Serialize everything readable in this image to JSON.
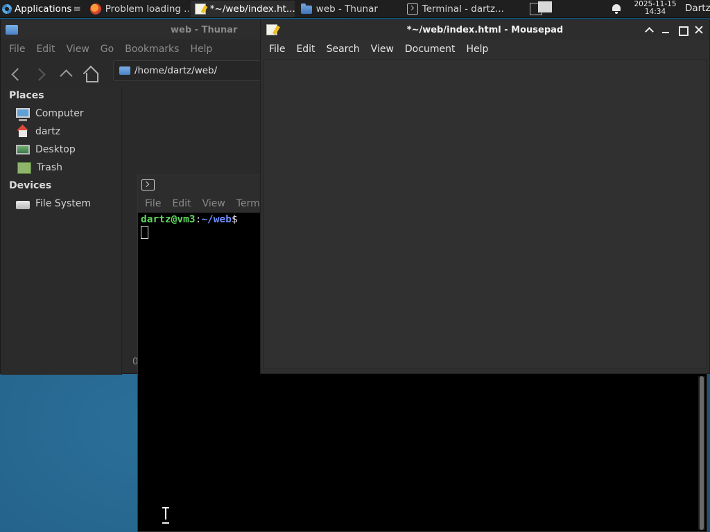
{
  "panel": {
    "app_menu_label": "Applications",
    "app_menu_sep": "≡",
    "tasks": [
      {
        "label": "Problem loading ...",
        "icon": "firefox-icon"
      },
      {
        "label": "*~/web/index.ht...",
        "icon": "mousepad-icon"
      },
      {
        "label": "web - Thunar",
        "icon": "folder-icon"
      },
      {
        "label": "Terminal - dartz...",
        "icon": "terminal-icon"
      }
    ],
    "clock_date": "2025-11-15",
    "clock_time": "14:34",
    "user": "Dartz"
  },
  "thunar": {
    "title": "web - Thunar",
    "menu": [
      "File",
      "Edit",
      "View",
      "Go",
      "Bookmarks",
      "Help"
    ],
    "location": "/home/dartz/web/",
    "places_heading": "Places",
    "places": [
      "Computer",
      "dartz",
      "Desktop",
      "Trash"
    ],
    "devices_heading": "Devices",
    "devices": [
      "File System"
    ],
    "status_text": "0"
  },
  "terminal": {
    "menu": [
      "File",
      "Edit",
      "View",
      "Termi"
    ],
    "prompt_user": "dartz@vm3",
    "prompt_sep": ":",
    "prompt_path": "~/web",
    "prompt_end": "$"
  },
  "mousepad": {
    "title": "*~/web/index.html - Mousepad",
    "menu": [
      "File",
      "Edit",
      "Search",
      "View",
      "Document",
      "Help"
    ]
  }
}
